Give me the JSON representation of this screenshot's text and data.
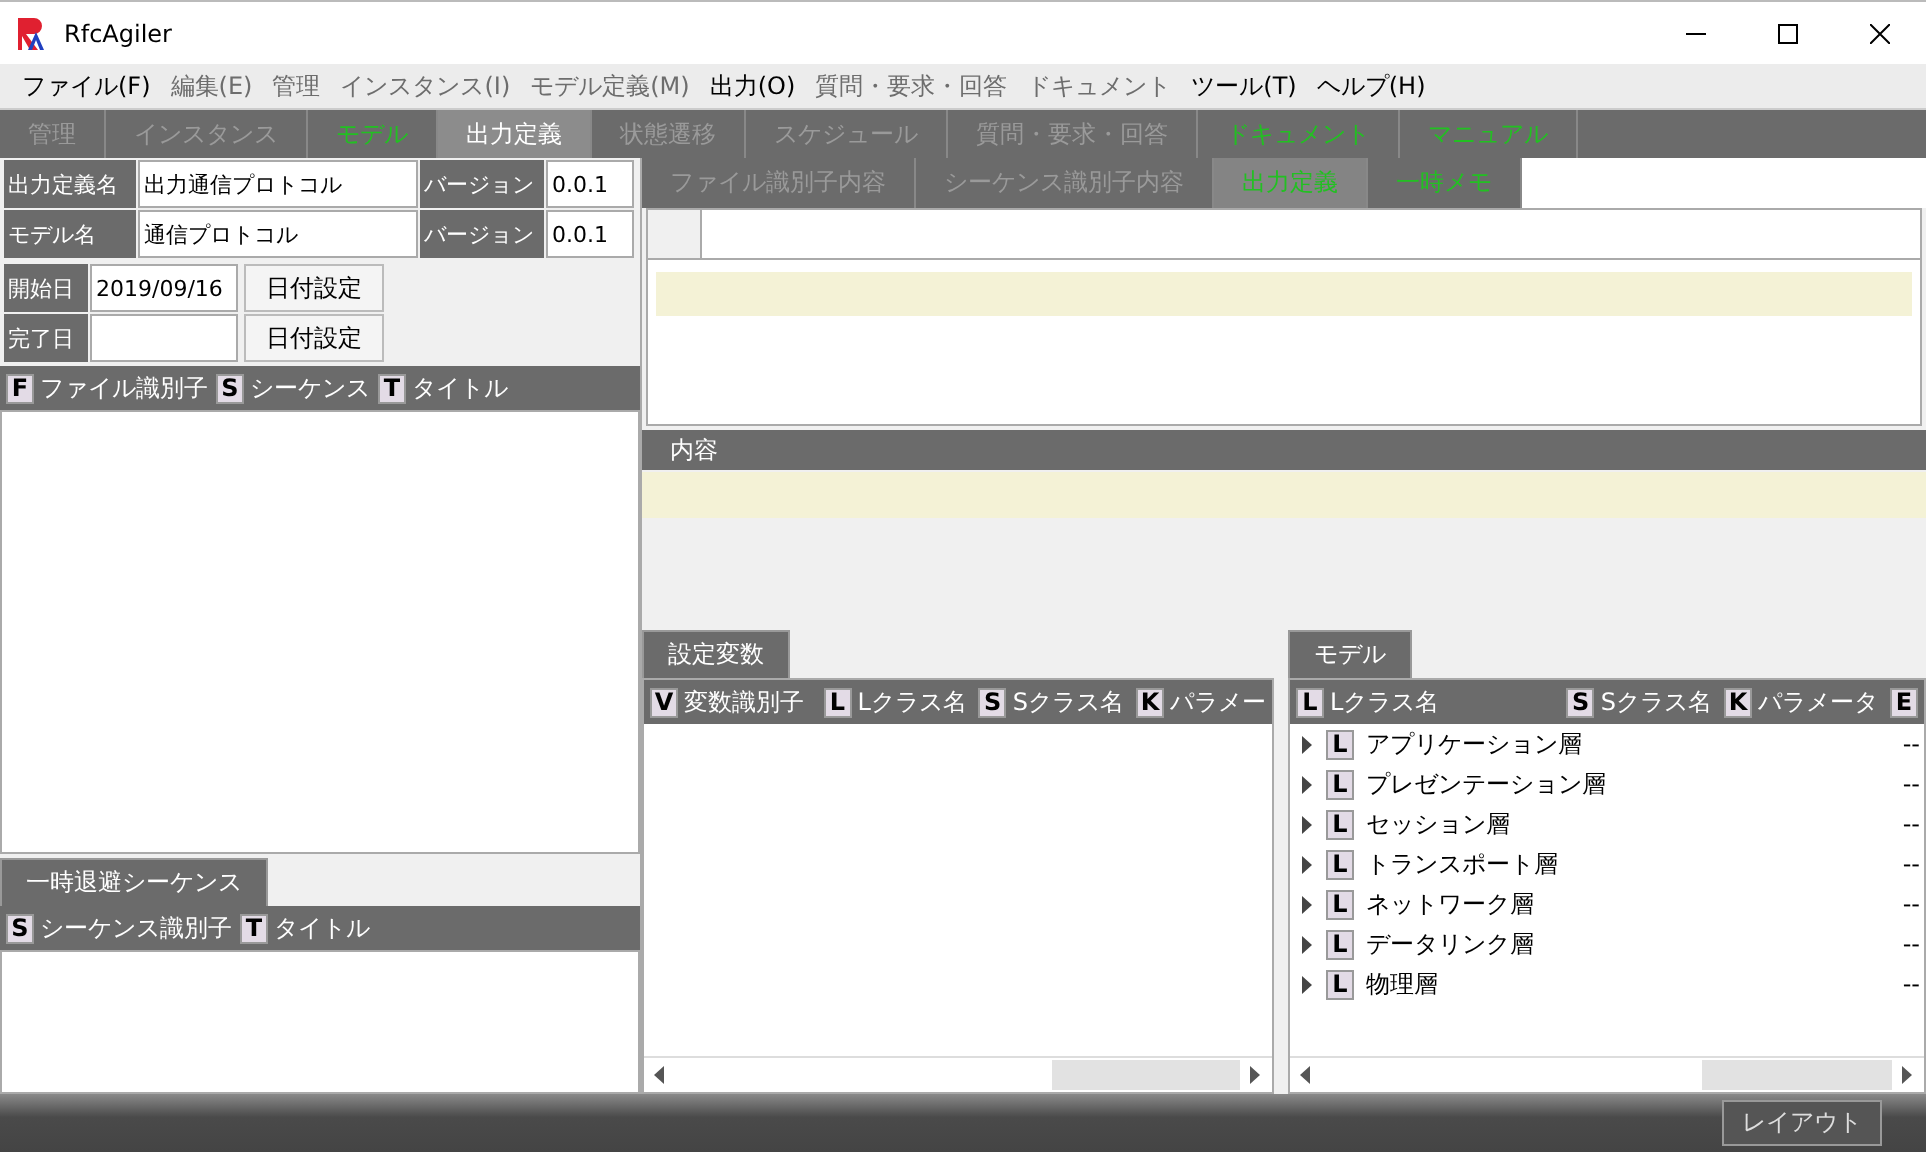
{
  "window": {
    "title": "RfcAgiler"
  },
  "menu": [
    {
      "label": "ファイル(F)",
      "disabled": false
    },
    {
      "label": "編集(E)",
      "disabled": true
    },
    {
      "label": "管理",
      "disabled": true
    },
    {
      "label": "インスタンス(I)",
      "disabled": true
    },
    {
      "label": "モデル定義(M)",
      "disabled": true
    },
    {
      "label": "出力(O)",
      "disabled": false
    },
    {
      "label": "質問・要求・回答",
      "disabled": true
    },
    {
      "label": "ドキュメント",
      "disabled": true
    },
    {
      "label": "ツール(T)",
      "disabled": false
    },
    {
      "label": "ヘルプ(H)",
      "disabled": false
    }
  ],
  "main_tabs": [
    {
      "label": "管理",
      "selected": false,
      "disabled": true,
      "highlighted": false
    },
    {
      "label": "インスタンス",
      "selected": false,
      "disabled": true,
      "highlighted": false
    },
    {
      "label": "モデル",
      "selected": false,
      "disabled": false,
      "highlighted": true
    },
    {
      "label": "出力定義",
      "selected": true,
      "disabled": false,
      "highlighted": false
    },
    {
      "label": "状態遷移",
      "selected": false,
      "disabled": true,
      "highlighted": false
    },
    {
      "label": "スケジュール",
      "selected": false,
      "disabled": true,
      "highlighted": false
    },
    {
      "label": "質問・要求・回答",
      "selected": false,
      "disabled": true,
      "highlighted": false
    },
    {
      "label": "ドキュメント",
      "selected": false,
      "disabled": false,
      "highlighted": true
    },
    {
      "label": "マニュアル",
      "selected": false,
      "disabled": false,
      "highlighted": true
    }
  ],
  "form": {
    "output_name": {
      "label": "出力定義名",
      "value": "出力通信プロトコル",
      "version_label": "バージョン",
      "version": "0.0.1"
    },
    "model_name": {
      "label": "モデル名",
      "value": "通信プロトコル",
      "version_label": "バージョン",
      "version": "0.0.1"
    },
    "start_date": {
      "label": "開始日",
      "value": "2019/09/16",
      "button": "日付設定"
    },
    "end_date": {
      "label": "完了日",
      "button": "日付設定"
    }
  },
  "file_list": {
    "columns": [
      {
        "badge": "F",
        "label": "ファイル識別子"
      },
      {
        "badge": "S",
        "label": "シーケンス"
      },
      {
        "badge": "T",
        "label": "タイトル"
      }
    ]
  },
  "temp_sequences": {
    "tab": "一時退避シーケンス",
    "columns": [
      {
        "badge": "S",
        "label": "シーケンス識別子"
      },
      {
        "badge": "T",
        "label": "タイトル"
      }
    ]
  },
  "sub_tabs": [
    {
      "label": "ファイル識別子内容",
      "selected": false,
      "disabled": true,
      "highlighted": false
    },
    {
      "label": "シーケンス識別子内容",
      "selected": false,
      "disabled": true,
      "highlighted": false
    },
    {
      "label": "出力定義",
      "selected": true,
      "disabled": false,
      "highlighted": true
    },
    {
      "label": "一時メモ",
      "selected": false,
      "disabled": false,
      "highlighted": true
    }
  ],
  "content": {
    "label": "内容"
  },
  "variables": {
    "tab": "設定変数",
    "columns": [
      {
        "badge": "V",
        "label": "変数識別子"
      },
      {
        "badge": "L",
        "label": "Lクラス名"
      },
      {
        "badge": "S",
        "label": "Sクラス名"
      },
      {
        "badge": "K",
        "label": "パラメー"
      }
    ]
  },
  "model": {
    "tab": "モデル",
    "columns": [
      {
        "badge": "L",
        "label": "Lクラス名"
      },
      {
        "badge": "S",
        "label": "Sクラス名"
      },
      {
        "badge": "K",
        "label": "パラメータ"
      },
      {
        "badge": "E"
      }
    ],
    "rows": [
      {
        "badge": "L",
        "name": "アプリケーション層",
        "expanded": false,
        "column_4": "--"
      },
      {
        "badge": "L",
        "name": "プレゼンテーション層",
        "expanded": false,
        "column_4": "--"
      },
      {
        "badge": "L",
        "name": "セッション層",
        "expanded": false,
        "column_4": "--"
      },
      {
        "badge": "L",
        "name": "トランスポート層",
        "expanded": false,
        "column_4": "--"
      },
      {
        "badge": "L",
        "name": "ネットワーク層",
        "expanded": false,
        "column_4": "--"
      },
      {
        "badge": "L",
        "name": "データリンク層",
        "expanded": false,
        "column_4": "--"
      },
      {
        "badge": "L",
        "name": "物理層",
        "expanded": false,
        "column_4": "--"
      }
    ]
  },
  "footer": {
    "button": "レイアウト"
  }
}
